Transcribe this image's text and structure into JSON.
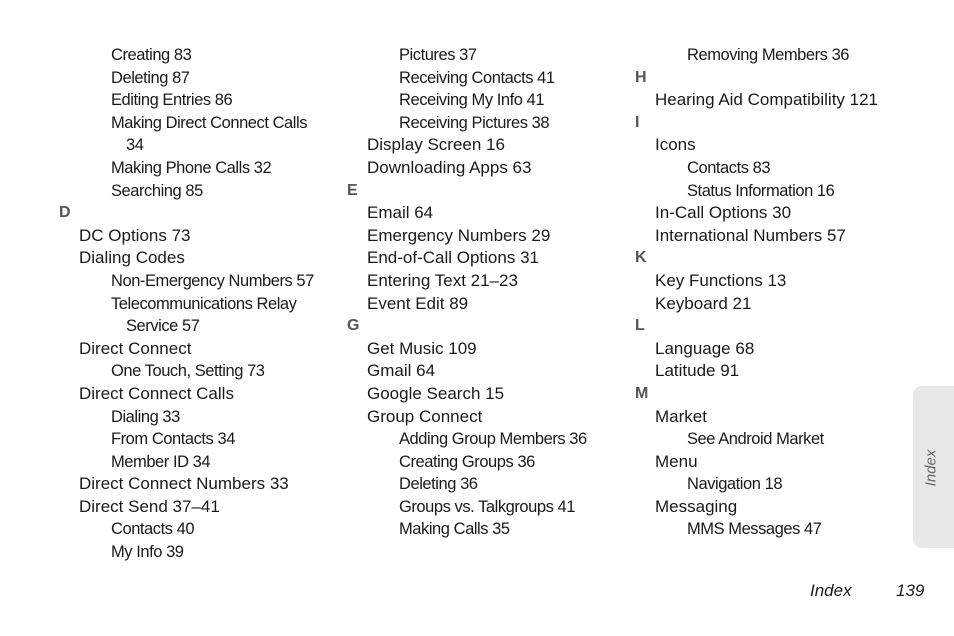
{
  "columns": [
    {
      "entries": [
        {
          "level": 2,
          "text": "Creating 83"
        },
        {
          "level": 2,
          "text": "Deleting 87"
        },
        {
          "level": 2,
          "text": "Editing Entries 86"
        },
        {
          "level": 2,
          "text": "Making Direct Connect Calls"
        },
        {
          "level": 3,
          "text": "34"
        },
        {
          "level": 2,
          "text": "Making Phone Calls 32"
        },
        {
          "level": 2,
          "text": "Searching 85"
        },
        {
          "level": 0,
          "text": "D"
        },
        {
          "level": 1,
          "text": "DC Options 73"
        },
        {
          "level": 1,
          "text": "Dialing Codes"
        },
        {
          "level": 2,
          "text": "Non-Emergency Numbers 57"
        },
        {
          "level": 2,
          "text": "Telecommunications Relay"
        },
        {
          "level": 3,
          "text": "Service 57"
        },
        {
          "level": 1,
          "text": "Direct Connect"
        },
        {
          "level": 2,
          "text": "One Touch, Setting 73"
        },
        {
          "level": 1,
          "text": "Direct Connect Calls"
        },
        {
          "level": 2,
          "text": "Dialing 33"
        },
        {
          "level": 2,
          "text": "From Contacts 34"
        },
        {
          "level": 2,
          "text": "Member ID 34"
        },
        {
          "level": 1,
          "text": "Direct Connect Numbers 33"
        },
        {
          "level": 1,
          "text": "Direct Send 37–41"
        },
        {
          "level": 2,
          "text": "Contacts 40"
        },
        {
          "level": 2,
          "text": "My Info 39"
        }
      ]
    },
    {
      "entries": [
        {
          "level": 2,
          "text": "Pictures 37"
        },
        {
          "level": 2,
          "text": "Receiving Contacts 41"
        },
        {
          "level": 2,
          "text": "Receiving My Info 41"
        },
        {
          "level": 2,
          "text": "Receiving Pictures 38"
        },
        {
          "level": 1,
          "text": "Display Screen 16"
        },
        {
          "level": 1,
          "text": "Downloading Apps 63"
        },
        {
          "level": 0,
          "text": "E"
        },
        {
          "level": 1,
          "text": "Email 64"
        },
        {
          "level": 1,
          "text": "Emergency Numbers 29"
        },
        {
          "level": 1,
          "text": "End-of-Call Options 31"
        },
        {
          "level": 1,
          "text": "Entering Text 21–23"
        },
        {
          "level": 1,
          "text": "Event Edit 89"
        },
        {
          "level": 0,
          "text": "G"
        },
        {
          "level": 1,
          "text": "Get Music 109"
        },
        {
          "level": 1,
          "text": "Gmail 64"
        },
        {
          "level": 1,
          "text": "Google Search 15"
        },
        {
          "level": 1,
          "text": "Group Connect"
        },
        {
          "level": 2,
          "text": "Adding Group Members 36"
        },
        {
          "level": 2,
          "text": "Creating Groups 36"
        },
        {
          "level": 2,
          "text": "Deleting 36"
        },
        {
          "level": 2,
          "text": "Groups vs. Talkgroups 41"
        },
        {
          "level": 2,
          "text": "Making Calls 35"
        }
      ]
    },
    {
      "entries": [
        {
          "level": 2,
          "text": "Removing Members 36"
        },
        {
          "level": 0,
          "text": "H"
        },
        {
          "level": 1,
          "text": "Hearing Aid Compatibility 121"
        },
        {
          "level": 0,
          "text": "I"
        },
        {
          "level": 1,
          "text": "Icons"
        },
        {
          "level": 2,
          "text": "Contacts 83"
        },
        {
          "level": 2,
          "text": "Status Information 16"
        },
        {
          "level": 1,
          "text": "In-Call Options 30"
        },
        {
          "level": 1,
          "text": "International Numbers 57"
        },
        {
          "level": 0,
          "text": "K"
        },
        {
          "level": 1,
          "text": "Key Functions 13"
        },
        {
          "level": 1,
          "text": "Keyboard 21"
        },
        {
          "level": 0,
          "text": "L"
        },
        {
          "level": 1,
          "text": "Language 68"
        },
        {
          "level": 1,
          "text": "Latitude 91"
        },
        {
          "level": 0,
          "text": "M"
        },
        {
          "level": 1,
          "text": "Market"
        },
        {
          "level": 2,
          "text": "See Android Market"
        },
        {
          "level": 1,
          "text": "Menu"
        },
        {
          "level": 2,
          "text": "Navigation 18"
        },
        {
          "level": 1,
          "text": "Messaging"
        },
        {
          "level": 2,
          "text": "MMS Messages 47"
        }
      ]
    }
  ],
  "side_tab": {
    "label": "Index"
  },
  "footer": {
    "section": "Index",
    "page": "139"
  }
}
